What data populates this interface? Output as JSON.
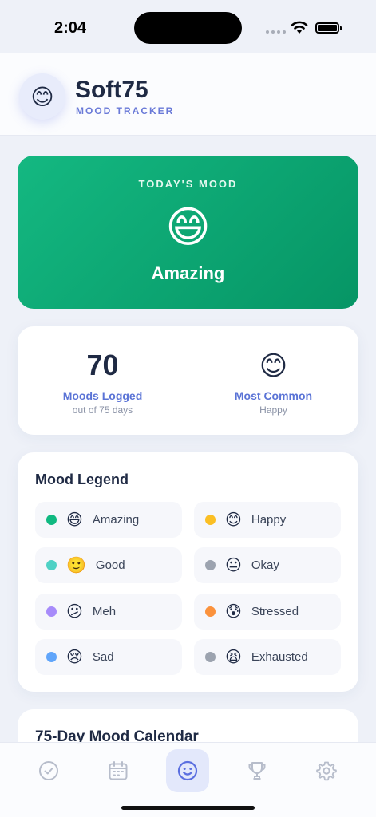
{
  "status_bar": {
    "time": "2:04"
  },
  "header": {
    "logo_emoji": "😊",
    "title": "Soft75",
    "subtitle": "MOOD TRACKER"
  },
  "today_mood": {
    "label": "TODAY'S MOOD",
    "emoji": "😄",
    "name": "Amazing",
    "color": "#10b27c"
  },
  "stats": {
    "moods_logged": {
      "value": "70",
      "label": "Moods Logged",
      "sub": "out of 75 days"
    },
    "most_common": {
      "emoji": "😊",
      "label": "Most Common",
      "sub": "Happy"
    }
  },
  "legend": {
    "title": "Mood Legend",
    "items": [
      {
        "label": "Amazing",
        "emoji": "😄",
        "color": "#10b981"
      },
      {
        "label": "Happy",
        "emoji": "😊",
        "color": "#fbbf24"
      },
      {
        "label": "Good",
        "emoji": "🙂",
        "color": "#4fd1c5"
      },
      {
        "label": "Okay",
        "emoji": "😐",
        "color": "#9ca3af"
      },
      {
        "label": "Meh",
        "emoji": "😕",
        "color": "#a78bfa"
      },
      {
        "label": "Stressed",
        "emoji": "😰",
        "color": "#fb923c"
      },
      {
        "label": "Sad",
        "emoji": "😢",
        "color": "#60a5fa"
      },
      {
        "label": "Exhausted",
        "emoji": "😫",
        "color": "#9ca3af"
      }
    ]
  },
  "calendar": {
    "title": "75-Day Mood Calendar"
  },
  "tabbar": {
    "items": [
      {
        "icon": "check-circle-icon",
        "active": false
      },
      {
        "icon": "calendar-icon",
        "active": false
      },
      {
        "icon": "smile-icon",
        "active": true
      },
      {
        "icon": "trophy-icon",
        "active": false
      },
      {
        "icon": "gear-icon",
        "active": false
      }
    ],
    "active_color": "#5b6fe0",
    "inactive_color": "#b7bdcb"
  }
}
